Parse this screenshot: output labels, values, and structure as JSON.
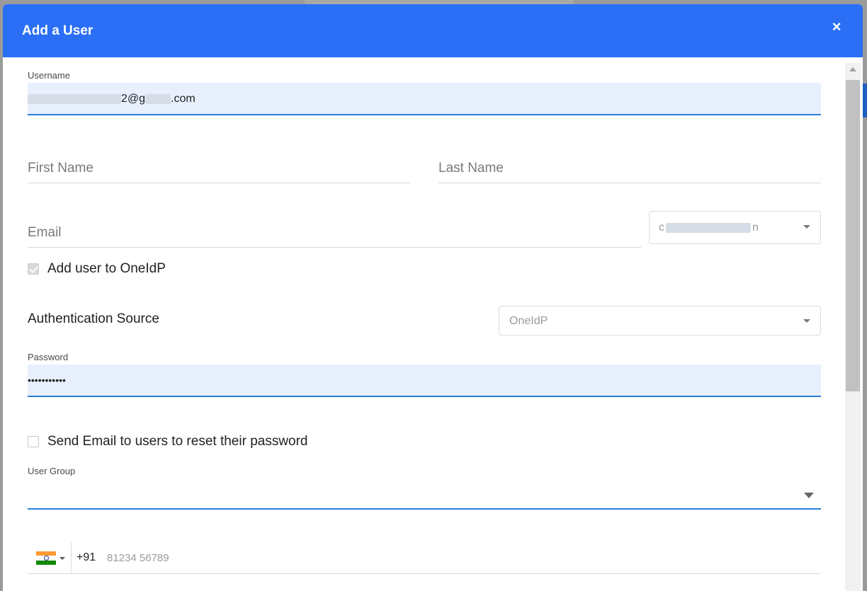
{
  "modal": {
    "title": "Add a User",
    "close_label": "×"
  },
  "username": {
    "label": "Username",
    "value_suffix_1": "2@g",
    "value_suffix_2": ".com"
  },
  "first_name": {
    "placeholder": "First Name"
  },
  "last_name": {
    "placeholder": "Last Name"
  },
  "email": {
    "placeholder": "Email",
    "domain_prefix": "c",
    "domain_suffix": "n"
  },
  "add_to_oneidp": {
    "label": "Add user to OneIdP",
    "checked": true
  },
  "auth_source": {
    "label": "Authentication Source",
    "selected": "OneIdP"
  },
  "password": {
    "label": "Password",
    "value": "•••••••••••"
  },
  "send_email": {
    "label": "Send Email to users to reset their password",
    "checked": false
  },
  "user_group": {
    "label": "User Group",
    "selected": ""
  },
  "phone": {
    "country_code": "+91",
    "placeholder": "81234 56789",
    "flag_colors": [
      "#ff9933",
      "#ffffff",
      "#138808"
    ]
  },
  "colors": {
    "header": "#2a6ff5",
    "focus_underline": "#2a7fd9",
    "filled_bg": "#e8f0fe"
  }
}
